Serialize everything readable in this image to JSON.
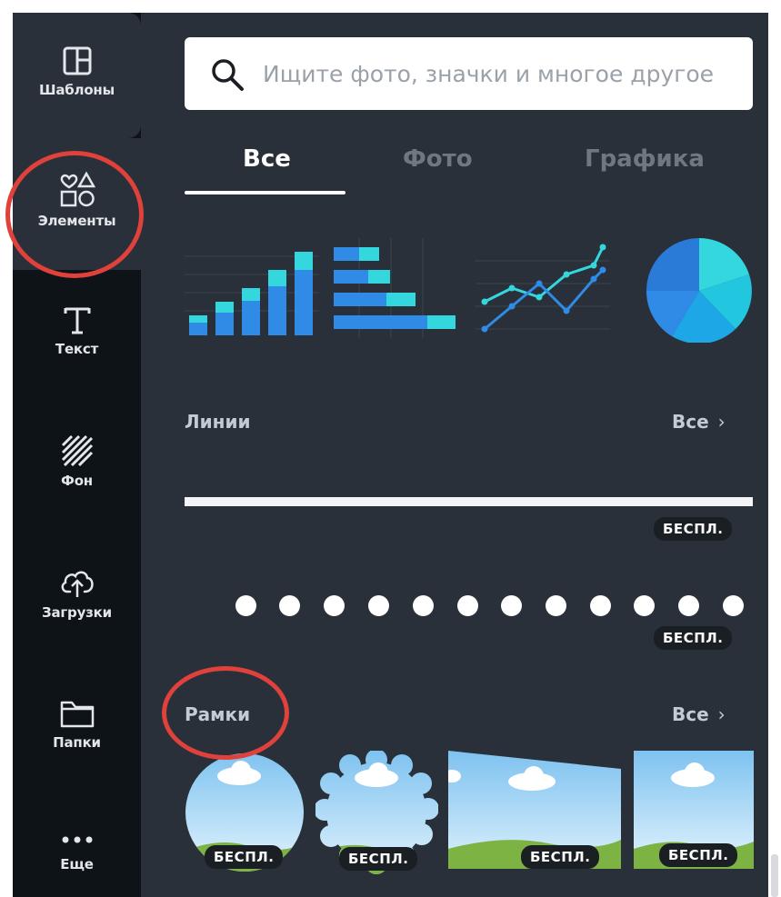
{
  "sidebar": {
    "items": [
      {
        "label": "Шаблоны",
        "icon": "layout-icon"
      },
      {
        "label": "Элементы",
        "icon": "shapes-icon",
        "active": true
      },
      {
        "label": "Текст",
        "icon": "text-icon"
      },
      {
        "label": "Фон",
        "icon": "background-stripes-icon"
      },
      {
        "label": "Загрузки",
        "icon": "cloud-upload-icon"
      },
      {
        "label": "Папки",
        "icon": "folder-icon"
      },
      {
        "label": "Еще",
        "icon": "more-dots-icon"
      }
    ]
  },
  "search": {
    "placeholder": "Ищите фото, значки и многое другое"
  },
  "tabs": [
    {
      "label": "Все",
      "active": true
    },
    {
      "label": "Фото"
    },
    {
      "label": "Графика"
    }
  ],
  "lines_section": {
    "title": "Линии",
    "see_all": "Все",
    "items": [
      {
        "badge": "БЕСПЛ."
      },
      {
        "badge": "БЕСПЛ."
      }
    ]
  },
  "frames_section": {
    "title": "Рамки",
    "see_all": "Все",
    "items": [
      {
        "badge": "БЕСПЛ."
      },
      {
        "badge": "БЕСПЛ."
      },
      {
        "badge": "БЕСПЛ."
      },
      {
        "badge": "БЕСПЛ."
      }
    ]
  },
  "colors": {
    "sidebar_bg": "#0e1318",
    "panel_bg": "#293039",
    "highlight_ring": "#e0413a",
    "chart_blue": "#2f8be6",
    "chart_cyan": "#35d7de"
  }
}
